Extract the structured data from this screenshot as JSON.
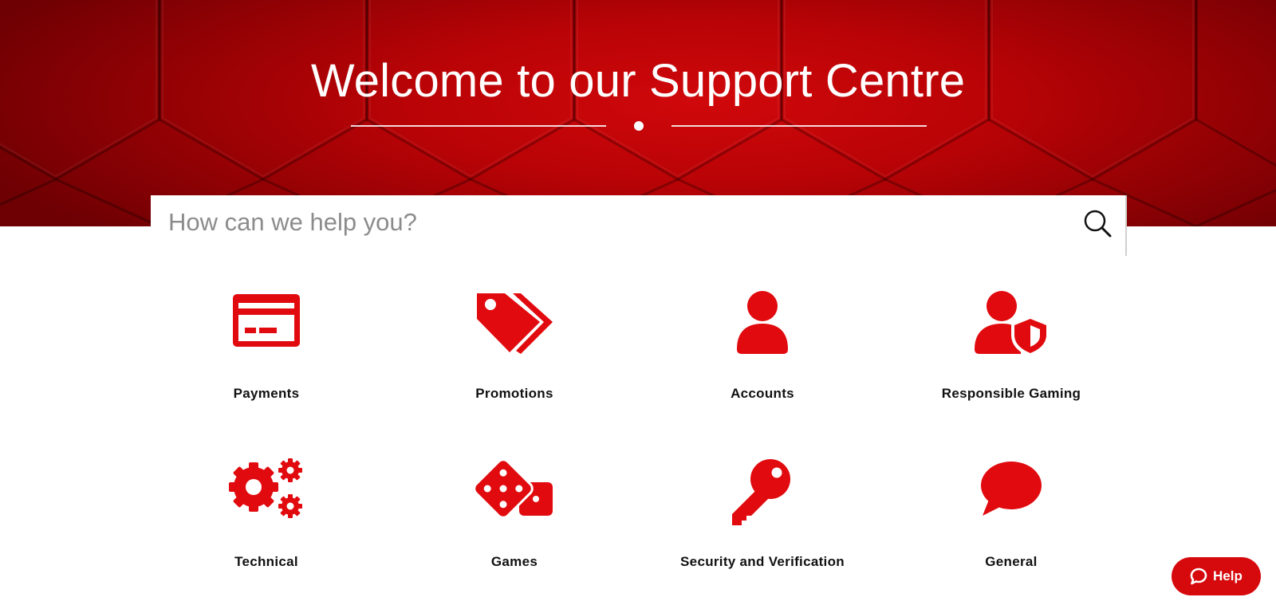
{
  "hero": {
    "title": "Welcome to our Support Centre"
  },
  "search": {
    "placeholder": "How can we help you?",
    "value": ""
  },
  "categories": [
    {
      "label": "Payments",
      "icon": "credit-card-icon"
    },
    {
      "label": "Promotions",
      "icon": "tags-icon"
    },
    {
      "label": "Accounts",
      "icon": "user-icon"
    },
    {
      "label": "Responsible Gaming",
      "icon": "user-shield-icon"
    },
    {
      "label": "Technical",
      "icon": "gears-icon"
    },
    {
      "label": "Games",
      "icon": "dice-icon"
    },
    {
      "label": "Security and Verification",
      "icon": "key-icon"
    },
    {
      "label": "General",
      "icon": "chat-bubble-icon"
    }
  ],
  "help_button": {
    "label": "Help",
    "icon": "chat-icon"
  },
  "colors": {
    "brand_red": "#d6090d",
    "hero_red_dark": "#6e0003",
    "hero_red_light": "#d0080b",
    "text_dark": "#111111",
    "placeholder_gray": "#8c8c8c"
  }
}
